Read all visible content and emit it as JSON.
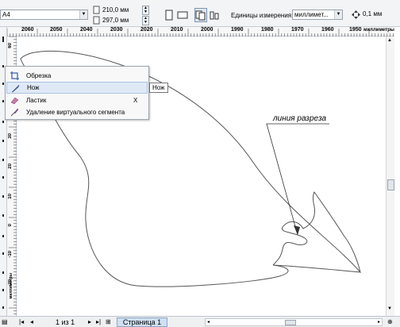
{
  "property_bar": {
    "paper_size": "A4",
    "width": "210,0 мм",
    "height": "297,0 мм",
    "units_label": "Единицы измерения:",
    "units_value": "миллимет...",
    "nudge_value": "0,1 мм"
  },
  "ruler": {
    "horizontal_ticks": [
      "2060",
      "2050",
      "2040",
      "2030",
      "2020",
      "2010",
      "2000",
      "1990",
      "1980",
      "1970",
      "1960",
      "1950",
      "миллиметры"
    ],
    "vertical_ticks": [
      "60",
      "50",
      "40",
      "30",
      "20",
      "10",
      "0",
      "-10",
      "-20",
      "-30"
    ],
    "vertical_unit": "миллиметры"
  },
  "menu": {
    "items": [
      {
        "label": "Обрезка",
        "icon": "crop-icon",
        "shortcut": ""
      },
      {
        "label": "Нож",
        "icon": "knife-icon",
        "shortcut": ""
      },
      {
        "label": "Ластик",
        "icon": "eraser-icon",
        "shortcut": "X"
      },
      {
        "label": "Удаление виртуального сегмента",
        "icon": "virtual-segment-delete-icon",
        "shortcut": ""
      }
    ],
    "highlighted_index": 1,
    "tooltip": "Нож"
  },
  "drawing": {
    "annotation": "линия разреза"
  },
  "page_bar": {
    "page_count": "1 из 1",
    "page_tab": "Страница 1"
  },
  "colors": {
    "toolbar_bg": "#f3f4f6",
    "highlight": "#dfe9f6",
    "page_tab": "#cfe0f3"
  }
}
